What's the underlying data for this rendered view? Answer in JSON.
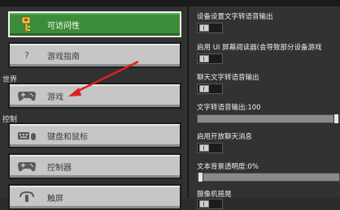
{
  "sidebar": {
    "items": [
      {
        "label": "可访问性",
        "icon": "key-icon",
        "active": true
      },
      {
        "label": "游戏指南",
        "icon": "question-icon",
        "active": false
      },
      {
        "label": "游戏",
        "icon": "gamepad-icon",
        "active": false
      },
      {
        "label": "键盘和鼠标",
        "icon": "keyboard-mouse-icon",
        "active": false
      },
      {
        "label": "控制器",
        "icon": "controller-icon",
        "active": false
      },
      {
        "label": "触屏",
        "icon": "touch-icon",
        "active": false
      }
    ],
    "sections": {
      "world": "世界",
      "controls": "控制"
    }
  },
  "settings": {
    "device_tts": "设备设置文字转语音输出",
    "screen_reader": "启用 UI 屏幕阅读器(会导致部分设备游戏",
    "chat_tts": "聊天文字转语音输出",
    "tts_volume": "文字转语音输出:100",
    "open_chat": "启用开放聊天消息",
    "text_bg_opacity": "文本背景透明度:0%",
    "camera_shake": "摄像机摇晃",
    "tts_volume_value": 1.0,
    "text_bg_opacity_value": 0.0
  },
  "colors": {
    "active": "#3d8c3a",
    "button": "#c6c6c6",
    "arrow": "#e02020"
  }
}
